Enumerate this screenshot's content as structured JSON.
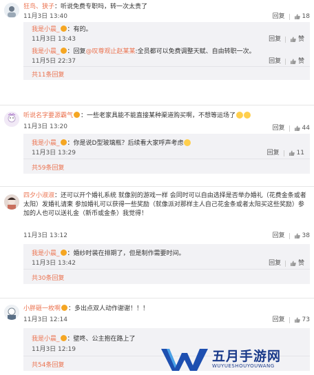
{
  "threads": [
    {
      "user": "狂鸟、狭子",
      "text": "：听说免费专职吗，转一次太贵了",
      "time": "11月3日 13:40",
      "reply_label": "回复",
      "likes": "18",
      "replies": [
        {
          "user": "我是小晨_",
          "text": "：有的。",
          "time": "11月3日 13:43",
          "reply_label": "回复",
          "likes": "赞"
        },
        {
          "user": "我是小晨_",
          "prefix": "：回复",
          "mention": "@叹尊观止赵某某",
          "text": ":全员都可以免费调整天赋、自由转职一次。",
          "time": "11月5日 22:37",
          "reply_label": "回复",
          "likes": "赞"
        }
      ],
      "more": "共11条回复"
    },
    {
      "user": "听说名字要源霸气",
      "text": "：一些老家具能不能直接某种渠道购买啊，不想等运场了",
      "time": "11月3日 13:20",
      "reply_label": "回复",
      "likes": "44",
      "replies": [
        {
          "user": "我是小晨_",
          "text": "：你是说D型玻璃瓶？后续看大家呼声考虑",
          "time": "11月3日 13:29",
          "reply_label": "回复",
          "likes": "11"
        }
      ],
      "more": "共59条回复"
    },
    {
      "user": "四夕小淑淑",
      "text": "：还可以开个婚礼系统 就像别的游戏一样 会同时可以自由选择是否举办婚礼（花费金条或者太阳）发婚礼请柬 参加婚礼可以获得一些奖励（就像派对那样主人自己花金条或者太阳买这些奖励）参加的人也可以送礼金（新币或金条）我觉得！",
      "time": "11月3日 13:12",
      "reply_label": "回复",
      "likes": "38",
      "replies": [
        {
          "user": "我是小晨_",
          "text": "：婚纱时装在排期了，但是制作需要时间。",
          "time": "11月3日 13:42",
          "reply_label": "回复",
          "likes": "赞"
        }
      ],
      "more": "共30条回复"
    },
    {
      "user": "小胖砸一枚啊",
      "text": "：多出点双人动作谢谢！！！",
      "time": "11月3日 12:14",
      "reply_label": "回复",
      "likes": "73",
      "replies": [
        {
          "user": "我是小晨_",
          "text": "：壁咚、公主抱在路上了",
          "time": "11月3日 12:19",
          "reply_label": "回复",
          "likes": "赞"
        }
      ],
      "more": "共54条回复"
    }
  ],
  "watermark": {
    "title": "五月手游网",
    "subtitle": "WUYUESHOUYOUWANG"
  },
  "colors": {
    "username": "#eb7350",
    "reply_bg": "#f2f2f5",
    "brand": "#1a3a8a"
  }
}
